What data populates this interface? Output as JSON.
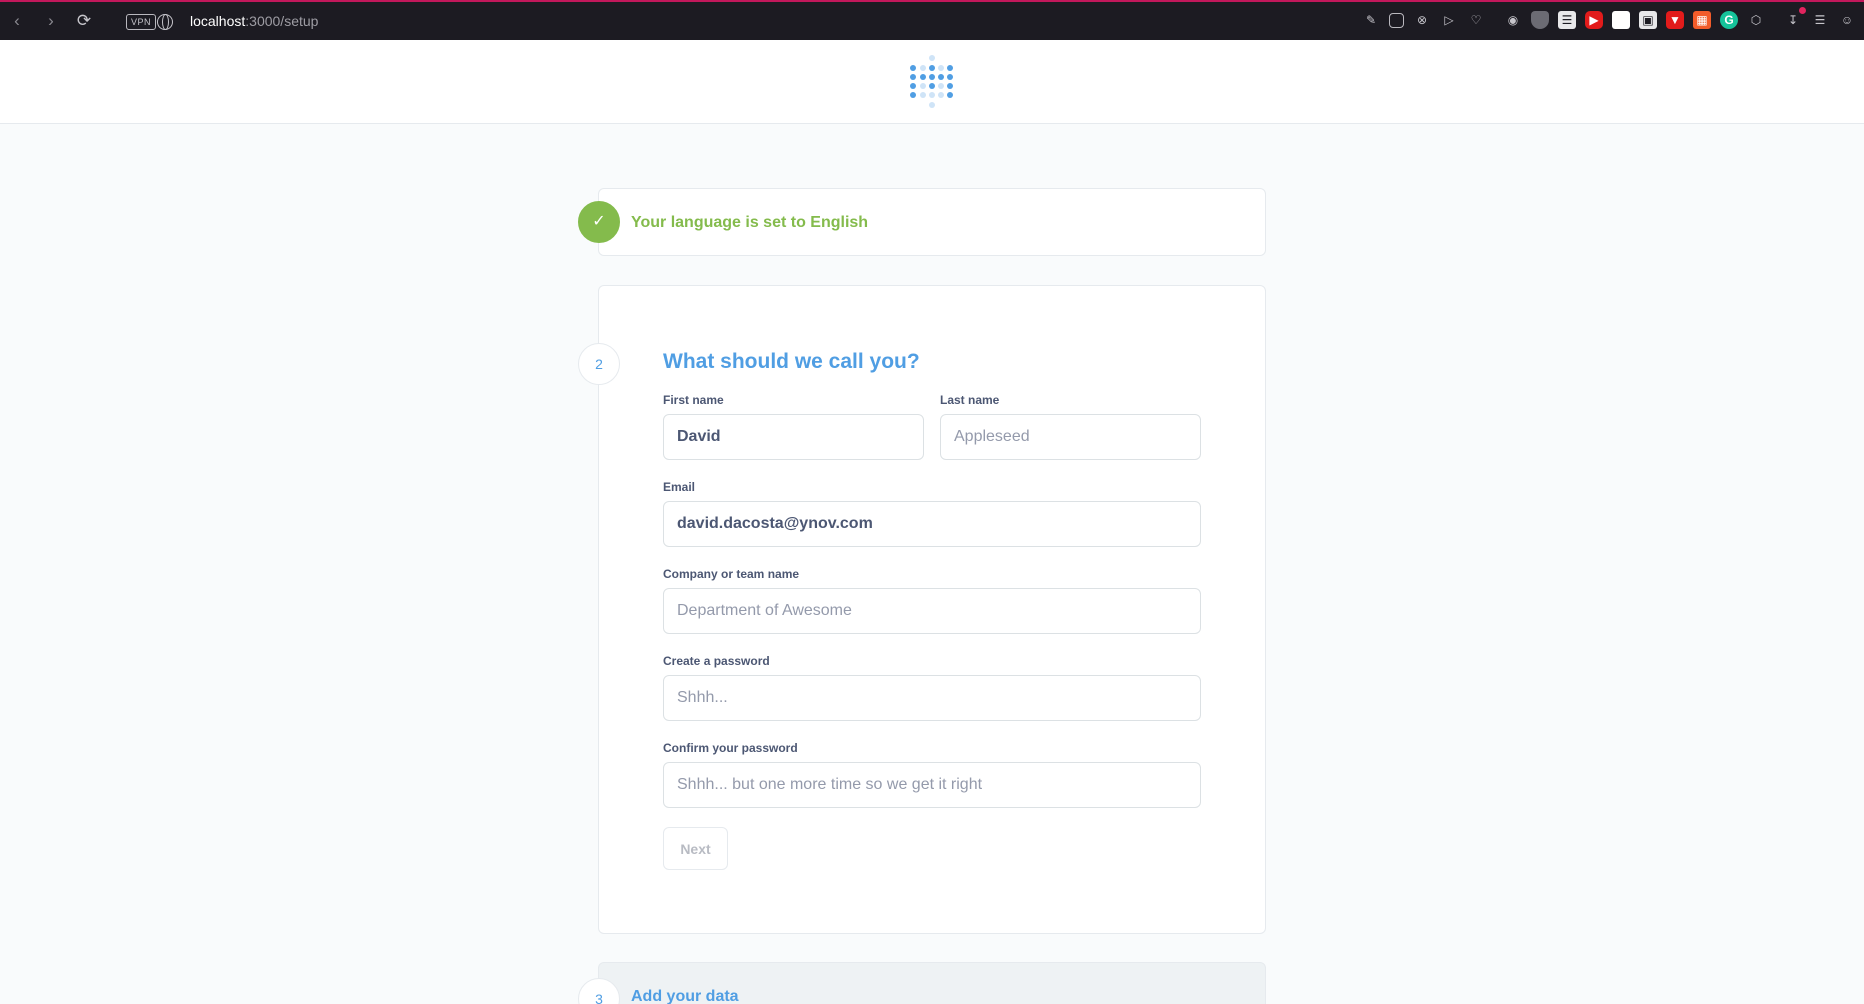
{
  "browser": {
    "url_host": "localhost",
    "url_path": ":3000/setup",
    "vpn_label": "VPN"
  },
  "step1": {
    "badge_icon": "check-icon",
    "label": "Your language is set to English"
  },
  "step2": {
    "number": "2",
    "title": "What should we call you?",
    "first_name": {
      "label": "First name",
      "value": "David",
      "placeholder": ""
    },
    "last_name": {
      "label": "Last name",
      "value": "",
      "placeholder": "Appleseed"
    },
    "email": {
      "label": "Email",
      "value": "david.dacosta@ynov.com",
      "placeholder": ""
    },
    "company": {
      "label": "Company or team name",
      "value": "",
      "placeholder": "Department of Awesome"
    },
    "password": {
      "label": "Create a password",
      "value": "",
      "placeholder": "Shhh..."
    },
    "confirm_password": {
      "label": "Confirm your password",
      "value": "",
      "placeholder": "Shhh... but one more time so we get it right"
    },
    "next_label": "Next"
  },
  "step3": {
    "number": "3",
    "title": "Add your data"
  },
  "colors": {
    "brand": "#509ee3",
    "success": "#84bb4c",
    "text": "#4c5773",
    "border": "#e6eaee"
  }
}
